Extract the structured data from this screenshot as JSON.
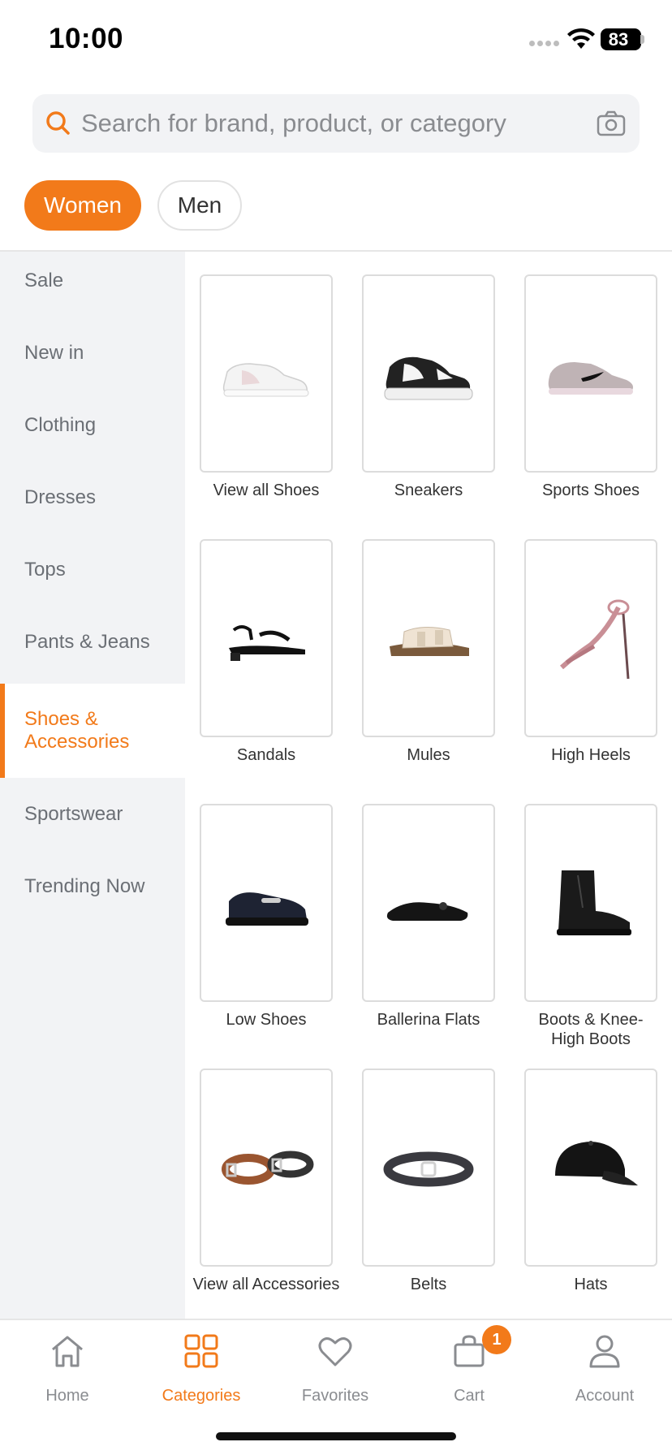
{
  "status": {
    "time": "10:00",
    "battery": "83"
  },
  "search": {
    "placeholder": "Search for brand, product, or category"
  },
  "gender_tabs": [
    {
      "label": "Women"
    },
    {
      "label": "Men"
    }
  ],
  "sidebar": {
    "items": [
      {
        "label": "Sale"
      },
      {
        "label": "New in"
      },
      {
        "label": "Clothing"
      },
      {
        "label": "Dresses"
      },
      {
        "label": "Tops"
      },
      {
        "label": "Pants & Jeans"
      },
      {
        "label": "Shoes &\nAccessories"
      },
      {
        "label": "Sportswear"
      },
      {
        "label": "Trending Now"
      }
    ]
  },
  "grid": {
    "items": [
      {
        "label": "View all Shoes",
        "icon": "sneaker-white-image"
      },
      {
        "label": "Sneakers",
        "icon": "sneaker-black-white-image"
      },
      {
        "label": "Sports Shoes",
        "icon": "sports-shoe-image"
      },
      {
        "label": "Sandals",
        "icon": "sandal-image"
      },
      {
        "label": "Mules",
        "icon": "mule-image"
      },
      {
        "label": "High Heels",
        "icon": "high-heel-image"
      },
      {
        "label": "Low Shoes",
        "icon": "loafer-image"
      },
      {
        "label": "Ballerina Flats",
        "icon": "ballerina-flat-image"
      },
      {
        "label": "Boots & Knee-\nHigh Boots",
        "icon": "boot-image"
      },
      {
        "label": "View all Accessories",
        "icon": "belts-image"
      },
      {
        "label": "Belts",
        "icon": "belt-image"
      },
      {
        "label": "Hats",
        "icon": "cap-image"
      }
    ]
  },
  "bottom_nav": {
    "items": [
      {
        "label": "Home",
        "icon": "home-icon"
      },
      {
        "label": "Categories",
        "icon": "categories-icon"
      },
      {
        "label": "Favorites",
        "icon": "heart-icon"
      },
      {
        "label": "Cart",
        "icon": "cart-icon",
        "badge": "1"
      },
      {
        "label": "Account",
        "icon": "account-icon"
      }
    ]
  },
  "colors": {
    "accent": "#f27a1a",
    "sidebar_bg": "#f2f3f5"
  }
}
